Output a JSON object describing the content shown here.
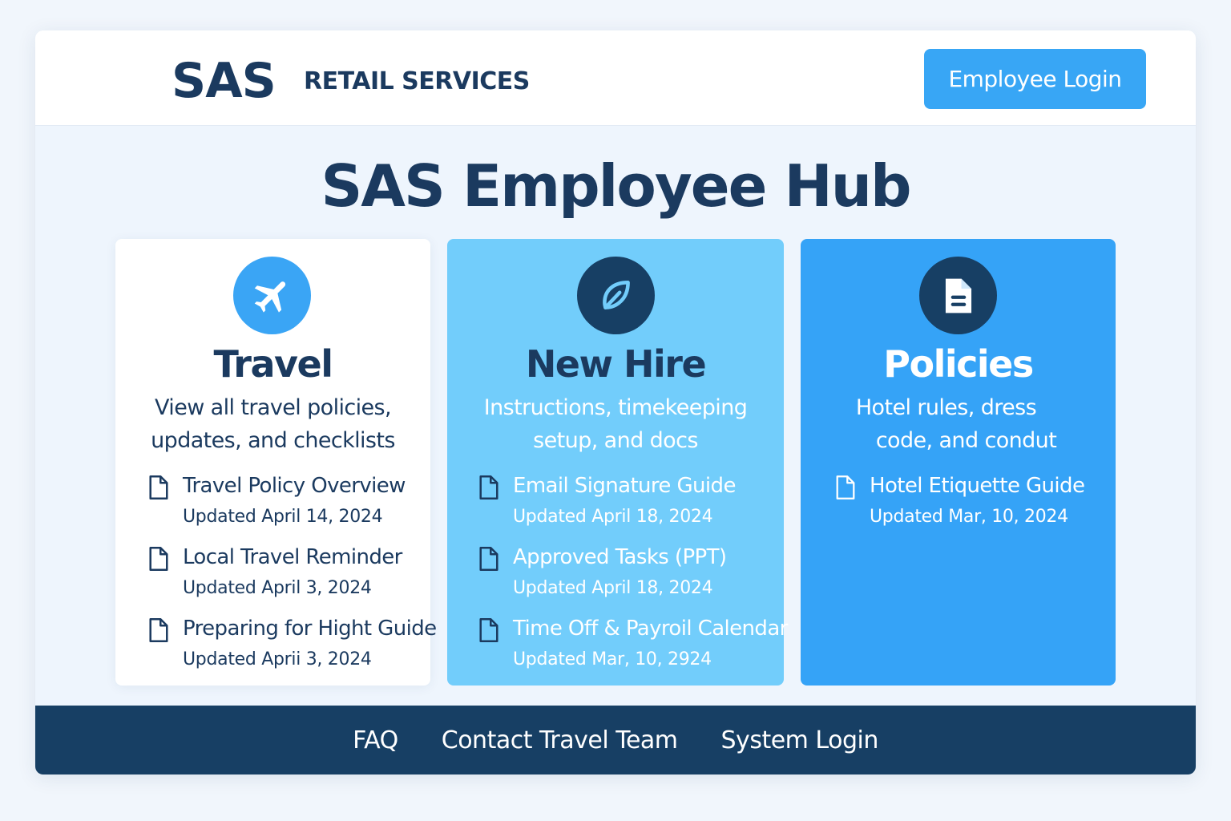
{
  "header": {
    "logo": "SAS",
    "tagline": "RETAIL SERVICES",
    "login_label": "Employee Login"
  },
  "hero": {
    "title": "SAS Employee Hub"
  },
  "cards": [
    {
      "title": "Travel",
      "icon": "airplane-icon",
      "desc_lines": [
        "View all travel policies,",
        "updates, and checklists"
      ],
      "docs": [
        {
          "title": "Travel Policy Overview",
          "date": "Updated April 14, 2024"
        },
        {
          "title": "Local Travel Reminder",
          "date": "Updated April 3, 2024"
        },
        {
          "title": "Preparing for Hight Guide",
          "date": "Updated Aprii 3, 2024"
        }
      ]
    },
    {
      "title": "New Hire",
      "icon": "leaf-icon",
      "desc_lines": [
        "Instructions, timekeeping",
        "setup, and docs"
      ],
      "docs": [
        {
          "title": "Email Signature Guide",
          "date": "Updated April 18, 2024"
        },
        {
          "title": "Approved Tasks (PPT)",
          "date": "Updated April 18, 2024"
        },
        {
          "title": "Time Off & Payroil Calendar",
          "date": "Updated Mar, 10, 2924"
        }
      ]
    },
    {
      "title": "Policies",
      "icon": "document-icon",
      "desc_lines": [
        "Hotel rules, dress",
        "code, and condut"
      ],
      "docs": [
        {
          "title": "Hotel Etiquette Guide",
          "date": "Updated Mar, 10, 2024"
        }
      ]
    }
  ],
  "footer": {
    "links": [
      "FAQ",
      "Contact Travel Team",
      "System Login"
    ]
  },
  "colors": {
    "navy": "#1b3a5f",
    "footer_bg": "#173f64",
    "accent_blue": "#35a3f7",
    "light_blue": "#72cdfb"
  }
}
